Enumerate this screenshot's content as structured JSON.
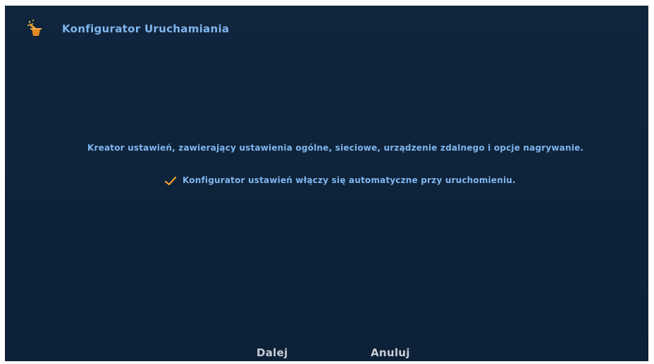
{
  "window": {
    "title": "Konfigurator Uruchamiania",
    "title_icon": "wizard-wand-icon"
  },
  "content": {
    "description": "Kreator ustawień, zawierający ustawienia ogólne, sieciowe, urządzenie zdalnego i opcje nagrywanie.",
    "auto_start": {
      "checked": true,
      "check_icon": "checkmark-icon",
      "label": "Konfigurator ustawień włączy się automatyczne przy uruchomieniu."
    }
  },
  "footer": {
    "next_label": "Dalej",
    "cancel_label": "Anuluj"
  },
  "colors": {
    "background": "#0d223a",
    "text": "#7fb6ee",
    "accent": "#f0a030",
    "button_text": "#c9ced6"
  }
}
